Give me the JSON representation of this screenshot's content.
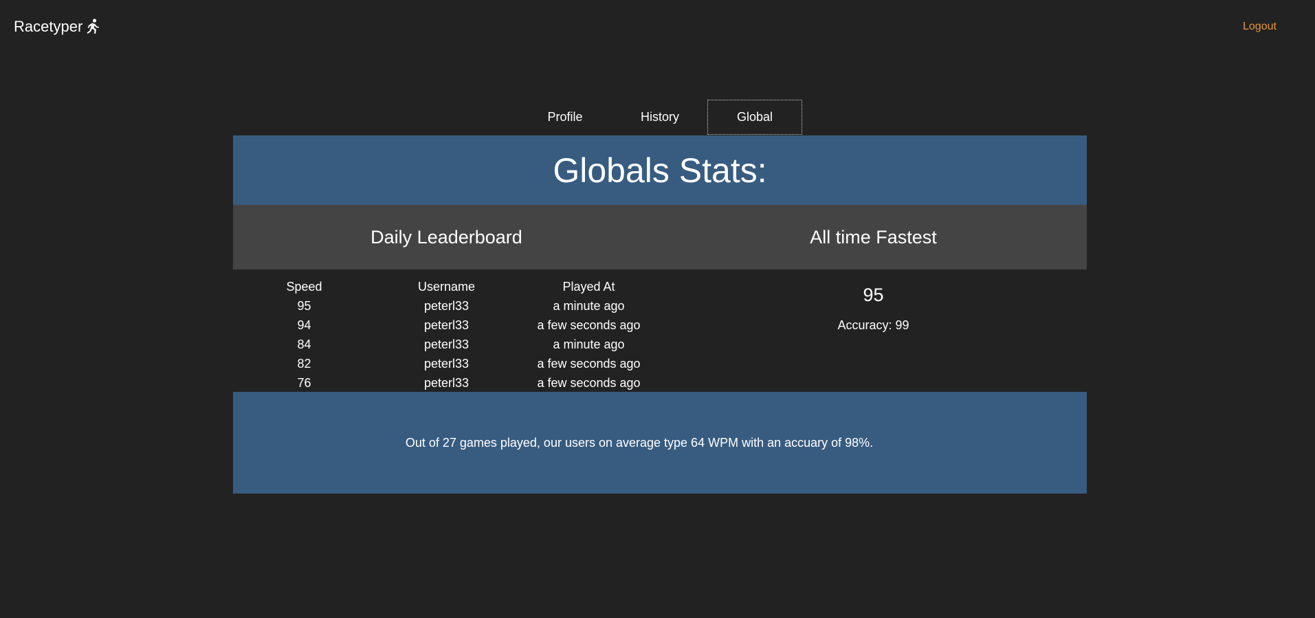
{
  "nav": {
    "brand": "Racetyper",
    "brand_icon": "running-person-icon",
    "logout": "Logout",
    "logout_color": "#e8963a"
  },
  "tabs": [
    {
      "label": "Profile",
      "active": false
    },
    {
      "label": "History",
      "active": false
    },
    {
      "label": "Global",
      "active": true
    }
  ],
  "banner": {
    "title": "Globals Stats:"
  },
  "daily": {
    "title": "Daily Leaderboard",
    "columns": [
      "Speed",
      "Username",
      "Played At"
    ],
    "rows": [
      [
        "95",
        "peterl33",
        "a minute ago"
      ],
      [
        "94",
        "peterl33",
        "a few seconds ago"
      ],
      [
        "84",
        "peterl33",
        "a minute ago"
      ],
      [
        "82",
        "peterl33",
        "a few seconds ago"
      ],
      [
        "76",
        "peterl33",
        "a few seconds ago"
      ]
    ]
  },
  "fastest": {
    "title": "All time Fastest",
    "speed": "95",
    "accuracy": "Accuracy: 99"
  },
  "summary": {
    "text": "Out of 27 games played, our users on average type 64 WPM with an accuary of 98%."
  },
  "colors": {
    "background": "#222222",
    "banner": "#385c80",
    "subheader": "#444444"
  }
}
